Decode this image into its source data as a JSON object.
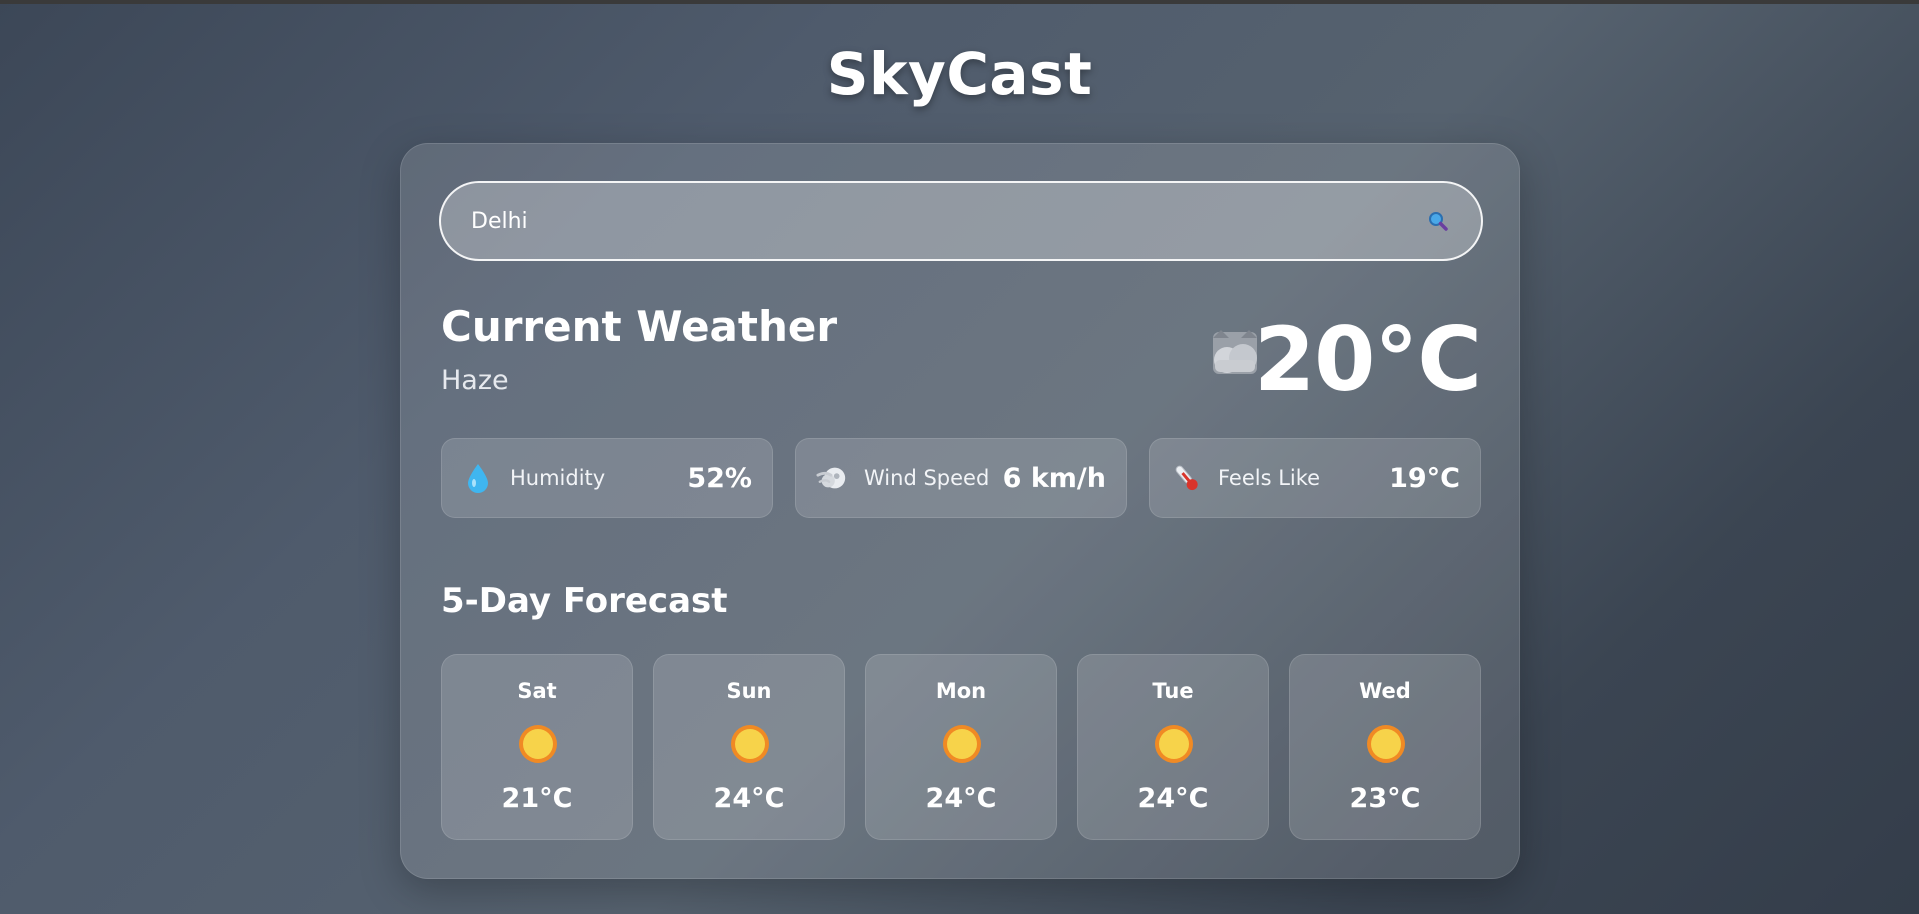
{
  "app": {
    "title": "SkyCast"
  },
  "search": {
    "value": "Delhi",
    "icon": "search-icon"
  },
  "current": {
    "heading": "Current Weather",
    "description": "Haze",
    "temperature": "20°C",
    "icon": "haze-icon"
  },
  "stats": [
    {
      "label": "Humidity",
      "value": "52%",
      "icon": "droplet-icon"
    },
    {
      "label": "Wind Speed",
      "value": "6 km/h",
      "icon": "wind-icon"
    },
    {
      "label": "Feels Like",
      "value": "19°C",
      "icon": "thermometer-icon"
    }
  ],
  "forecast": {
    "heading": "5-Day Forecast",
    "days": [
      {
        "day": "Sat",
        "temp": "21°C",
        "icon": "sun-icon"
      },
      {
        "day": "Sun",
        "temp": "24°C",
        "icon": "sun-icon"
      },
      {
        "day": "Mon",
        "temp": "24°C",
        "icon": "sun-icon"
      },
      {
        "day": "Tue",
        "temp": "24°C",
        "icon": "sun-icon"
      },
      {
        "day": "Wed",
        "temp": "23°C",
        "icon": "sun-icon"
      }
    ]
  },
  "colors": {
    "sun": "#f7d34a",
    "sun_ring": "#f08a24",
    "droplet": "#3fb6f0",
    "thermo_red": "#d9342b"
  }
}
